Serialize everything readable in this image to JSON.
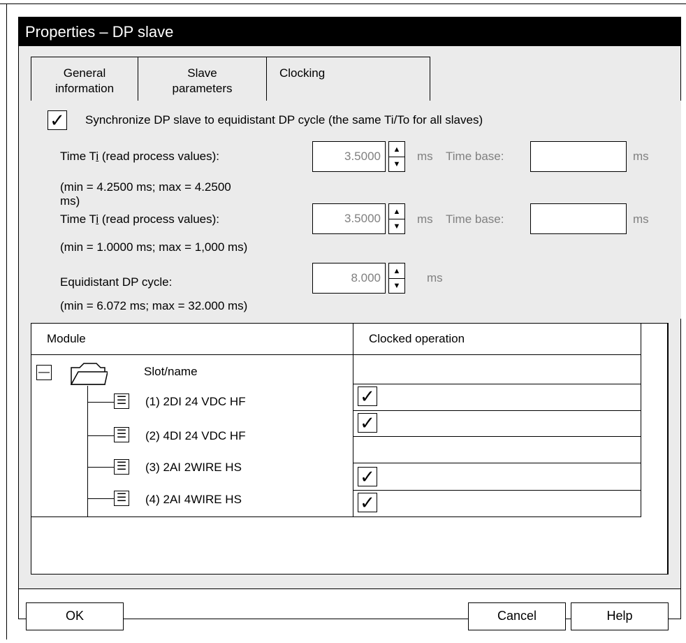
{
  "window": {
    "title": "Properties – DP slave"
  },
  "tabs": [
    {
      "line1": "General",
      "line2": "information"
    },
    {
      "line1": "Slave",
      "line2": "parameters"
    },
    {
      "line1": "Clocking",
      "line2": ""
    }
  ],
  "sync": {
    "checked": true,
    "label": "Synchronize DP slave to equidistant DP cycle (the same Ti/To for all slaves)"
  },
  "ti1": {
    "label_prefix": "Time T",
    "label_sub": "i",
    "label_suffix": " (read process values):",
    "value": "3.5000",
    "unit": "ms",
    "time_base_label": "Time base:",
    "time_base_value": "",
    "time_base_unit": "ms",
    "range_line1": "(min = 4.2500 ms;   max = 4.2500",
    "range_line2": "ms)"
  },
  "ti2": {
    "label_prefix": "Time T",
    "label_sub": "i",
    "label_suffix": " (read process values):",
    "value": "3.5000",
    "unit": "ms",
    "time_base_label": "Time base:",
    "time_base_value": "",
    "time_base_unit": "ms",
    "range": "(min = 1.0000 ms;   max = 1,000 ms)"
  },
  "cycle": {
    "label": "Equidistant DP cycle:",
    "value": "8.000",
    "unit": "ms",
    "range": "(min = 6.072 ms; max = 32.000 ms)"
  },
  "table": {
    "col_module": "Module",
    "col_clocked": "Clocked operation",
    "root": {
      "collapse_symbol": "—",
      "label": "Slot/name"
    },
    "rows": [
      {
        "label": "(1) 2DI 24 VDC HF",
        "clocked": true
      },
      {
        "label": "(2) 4DI 24 VDC HF",
        "clocked": true
      },
      {
        "label": "(3) 2AI 2WIRE HS",
        "clocked": true
      },
      {
        "label": "(4) 2AI 4WIRE HS",
        "clocked": true
      }
    ]
  },
  "buttons": {
    "ok": "OK",
    "cancel": "Cancel",
    "help": "Help"
  },
  "icons": {
    "checkmark": "✓",
    "spin_up": "▲",
    "spin_down": "▼",
    "module": "☰"
  }
}
